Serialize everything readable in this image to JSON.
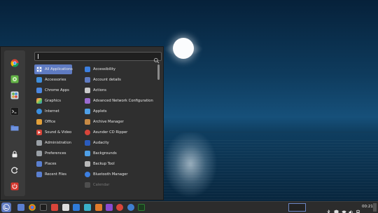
{
  "search": {
    "placeholder": "",
    "value": ""
  },
  "favorites": [
    {
      "name": "chrome-icon"
    },
    {
      "name": "settings-icon"
    },
    {
      "name": "software-manager-icon"
    },
    {
      "name": "terminal-icon"
    },
    {
      "name": "files-icon"
    }
  ],
  "session_buttons": [
    {
      "name": "lock-screen-icon"
    },
    {
      "name": "logout-icon"
    },
    {
      "name": "power-icon"
    }
  ],
  "categories": [
    {
      "label": "All Applications",
      "active": true,
      "color": "#5f7bc2"
    },
    {
      "label": "Accessories",
      "color": "#3f8edc"
    },
    {
      "label": "Chrome Apps",
      "color": "#4b87e0"
    },
    {
      "label": "Graphics",
      "color": "#d04d7a"
    },
    {
      "label": "Internet",
      "color": "#3b8fe0"
    },
    {
      "label": "Office",
      "color": "#e3a03a"
    },
    {
      "label": "Sound & Video",
      "color": "#d8453a"
    },
    {
      "label": "Administration",
      "color": "#9aa0a6"
    },
    {
      "label": "Preferences",
      "color": "#9aa0a6"
    },
    {
      "label": "Places",
      "color": "#5a7fd0"
    },
    {
      "label": "Recent Files",
      "color": "#5a7fd0"
    }
  ],
  "applications": [
    {
      "label": "Accessibility",
      "color": "#3c7fe0"
    },
    {
      "label": "Account details",
      "color": "#5f7bc2"
    },
    {
      "label": "Actions",
      "color": "#c9c9c9"
    },
    {
      "label": "Advanced Network Configuration",
      "color": "#9a6bd0"
    },
    {
      "label": "Applets",
      "color": "#4f9fe6"
    },
    {
      "label": "Archive Manager",
      "color": "#c78a45"
    },
    {
      "label": "Asunder CD Ripper",
      "color": "#d8453a"
    },
    {
      "label": "Audacity",
      "color": "#2a5bbd"
    },
    {
      "label": "Backgrounds",
      "color": "#4f9fe6"
    },
    {
      "label": "Backup Tool",
      "color": "#b9b9b9"
    },
    {
      "label": "Bluetooth Manager",
      "color": "#3c7fe0"
    },
    {
      "label": "Calendar",
      "color": "#8a8a8a",
      "dim": true
    }
  ],
  "taskbar": {
    "apps": [
      {
        "name": "files-taskbar-icon",
        "color": "#5a7fd0"
      },
      {
        "name": "chrome-taskbar-icon",
        "color": "#e0a93a"
      },
      {
        "name": "terminal-taskbar-icon",
        "color": "#1e1e1e"
      },
      {
        "name": "office-taskbar-icon",
        "color": "#d8453a"
      },
      {
        "name": "text-editor-taskbar-icon",
        "color": "#dcdcdc"
      },
      {
        "name": "notes-taskbar-icon",
        "color": "#2f7bd8"
      },
      {
        "name": "network-taskbar-icon",
        "color": "#3ab0c8"
      },
      {
        "name": "folder-taskbar-icon",
        "color": "#e07b2b"
      },
      {
        "name": "video-taskbar-icon",
        "color": "#8a4bd0"
      },
      {
        "name": "media-player-taskbar-icon",
        "color": "#d8453a"
      },
      {
        "name": "avatar-taskbar-icon",
        "color": "#3f7fd0"
      },
      {
        "name": "system-monitor-taskbar-icon",
        "color": "#2e7d32"
      }
    ],
    "tray": [
      {
        "name": "bluetooth-icon"
      },
      {
        "name": "shield-icon"
      },
      {
        "name": "wifi-icon"
      },
      {
        "name": "volume-icon"
      },
      {
        "name": "battery-icon"
      }
    ],
    "clock": "00:21"
  },
  "colors": {
    "accent": "#5f7bc2",
    "menu_bg": "#2f2f2f",
    "panel_bg": "#2c2c2c"
  }
}
